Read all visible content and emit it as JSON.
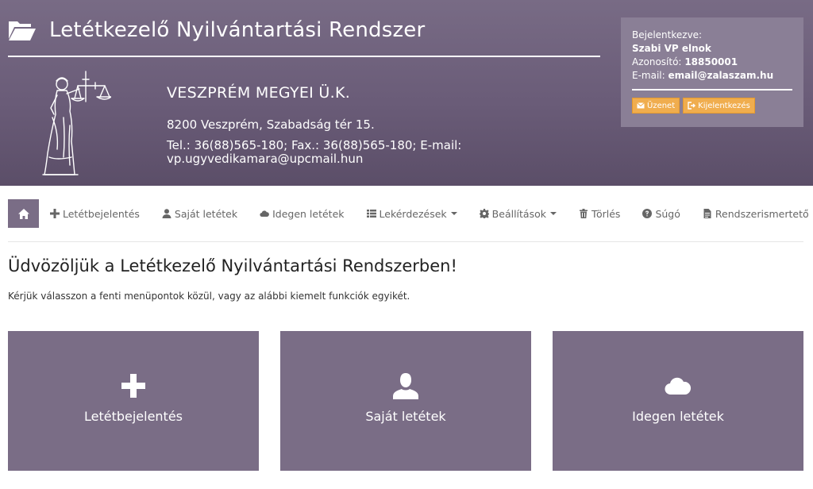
{
  "header": {
    "app_title": "Letétkezelő Nyilvántartási Rendszer",
    "org_name": "VESZPRÉM MEGYEI Ü.K.",
    "org_address": "8200 Veszprém, Szabadság tér 15.",
    "org_contact": "Tel.: 36(88)565-180; Fax.: 36(88)565-180; E-mail: vp.ugyvedikamara@upcmail.hun",
    "accent_color": "#6a5c78"
  },
  "user": {
    "logged_in_label": "Bejelentkezve:",
    "name": "Szabi VP elnok",
    "id_label": "Azonosító:",
    "id_value": "18850001",
    "email_label": "E-mail:",
    "email_value": "email@zalaszam.hu",
    "message_button": "Üzenet",
    "logout_button": "Kijelentkezés",
    "button_color": "#f0ad4e"
  },
  "nav": {
    "items": [
      {
        "label": "Letétbejelentés",
        "icon": "plus-icon"
      },
      {
        "label": "Saját letétek",
        "icon": "user-icon"
      },
      {
        "label": "Idegen letétek",
        "icon": "cloud-icon"
      },
      {
        "label": "Lekérdezések",
        "icon": "list-icon",
        "dropdown": true
      },
      {
        "label": "Beállítások",
        "icon": "gear-icon",
        "dropdown": true
      },
      {
        "label": "Törlés",
        "icon": "trash-icon"
      },
      {
        "label": "Súgó",
        "icon": "question-icon"
      },
      {
        "label": "Rendszerismertető",
        "icon": "document-icon",
        "dropdown": true
      }
    ]
  },
  "main": {
    "welcome": "Üdvözöljük a Letétkezelő Nyilvántartási Rendszerben!",
    "intro": "Kérjük válasszon a fenti menüpontok közül, vagy az alábbi kiemelt funkciók egyikét.",
    "tiles": [
      {
        "label": "Letétbejelentés",
        "icon": "plus-icon"
      },
      {
        "label": "Saját letétek",
        "icon": "user-icon"
      },
      {
        "label": "Idegen letétek",
        "icon": "cloud-icon"
      }
    ]
  }
}
